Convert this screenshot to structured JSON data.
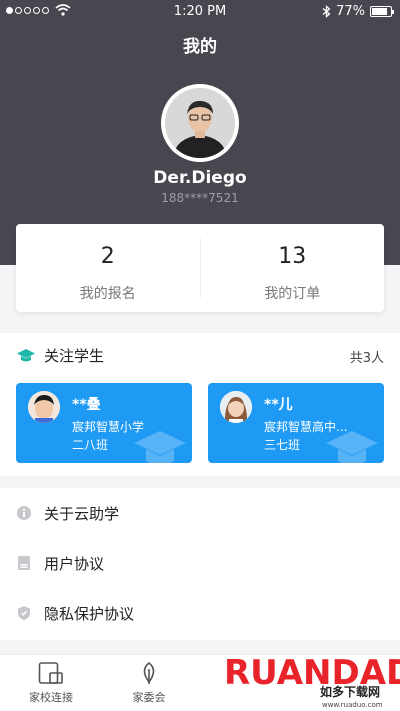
{
  "status_bar": {
    "time": "1:20 PM",
    "battery": "77%"
  },
  "header": {
    "title": "我的"
  },
  "user": {
    "name": "Der.Diego",
    "phone": "188****7521"
  },
  "stats": [
    {
      "value": "2",
      "label": "我的报名"
    },
    {
      "value": "13",
      "label": "我的订单"
    }
  ],
  "students": {
    "title": "关注学生",
    "count": "共3人",
    "items": [
      {
        "name": "**叠",
        "school": "宸邦智慧小学",
        "class": "二八班"
      },
      {
        "name": "**儿",
        "school": "宸邦智慧高中...",
        "class": "三七班"
      }
    ]
  },
  "menu": [
    {
      "label": "关于云助学",
      "icon": "info-icon"
    },
    {
      "label": "用户协议",
      "icon": "document-icon"
    },
    {
      "label": "隐私保护协议",
      "icon": "shield-icon"
    }
  ],
  "tabs": [
    {
      "label": "家校连接",
      "icon": "school-connect-icon"
    },
    {
      "label": "家委会",
      "icon": "leaf-icon"
    }
  ],
  "watermark": {
    "brand": "RUANDADO",
    "subtitle": "如多下载网",
    "url": "www.ruaduo.com"
  },
  "colors": {
    "header_bg": "#48474f",
    "accent": "#1e9af5",
    "student_icon": "#1fb7a6",
    "watermark_red": "#e8232a"
  }
}
